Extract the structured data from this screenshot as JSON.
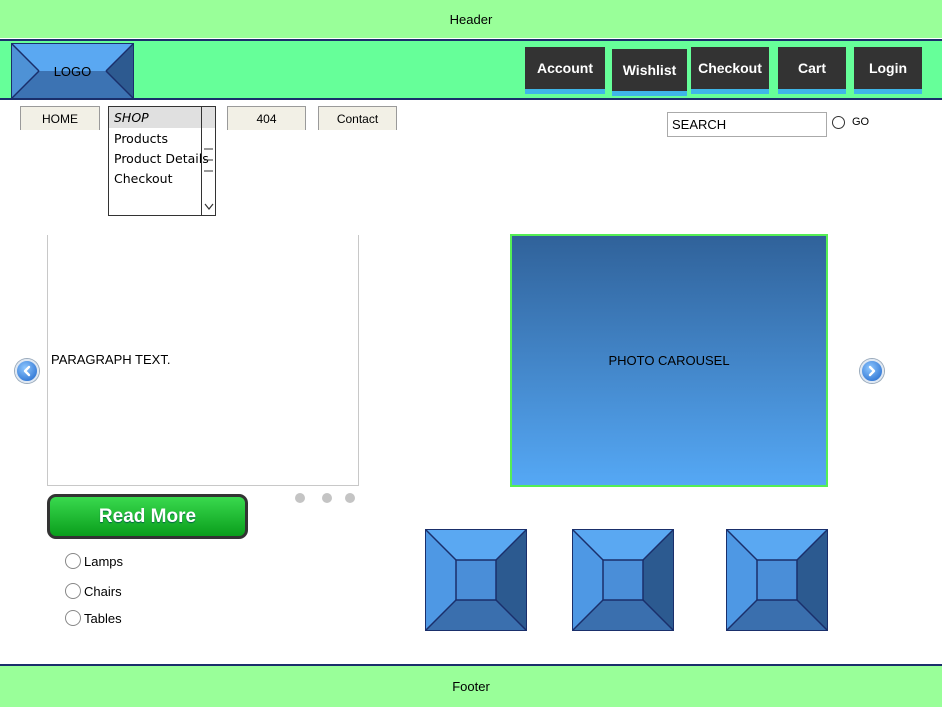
{
  "header": {
    "text": "Header"
  },
  "footer": {
    "text": "Footer"
  },
  "logo": {
    "text": "LOGO"
  },
  "topnav": {
    "account": "Account",
    "wishlist": "Wishlist",
    "checkout": "Checkout",
    "cart": "Cart",
    "login": "Login"
  },
  "tabs": {
    "home": "HOME",
    "notfound": "404",
    "contact": "Contact"
  },
  "shop_menu": {
    "title": "SHOP",
    "items": [
      "Products",
      "Product Details",
      "Checkout"
    ]
  },
  "search": {
    "value": "SEARCH",
    "go_label": "GO"
  },
  "paragraph": {
    "text": "PARAGRAPH TEXT."
  },
  "carousel": {
    "text": "PHOTO CAROUSEL",
    "prev_icon": "chevron-left-icon",
    "next_icon": "chevron-right-icon"
  },
  "read_more": {
    "label": "Read More"
  },
  "categories": [
    "Lamps",
    "Chairs",
    "Tables"
  ],
  "colors": {
    "band": "#99ff99",
    "topbar": "#66ff99",
    "button": "#333333",
    "button_accent": "#3fb6e8",
    "placeholder_blue": "#4ea3f0"
  }
}
